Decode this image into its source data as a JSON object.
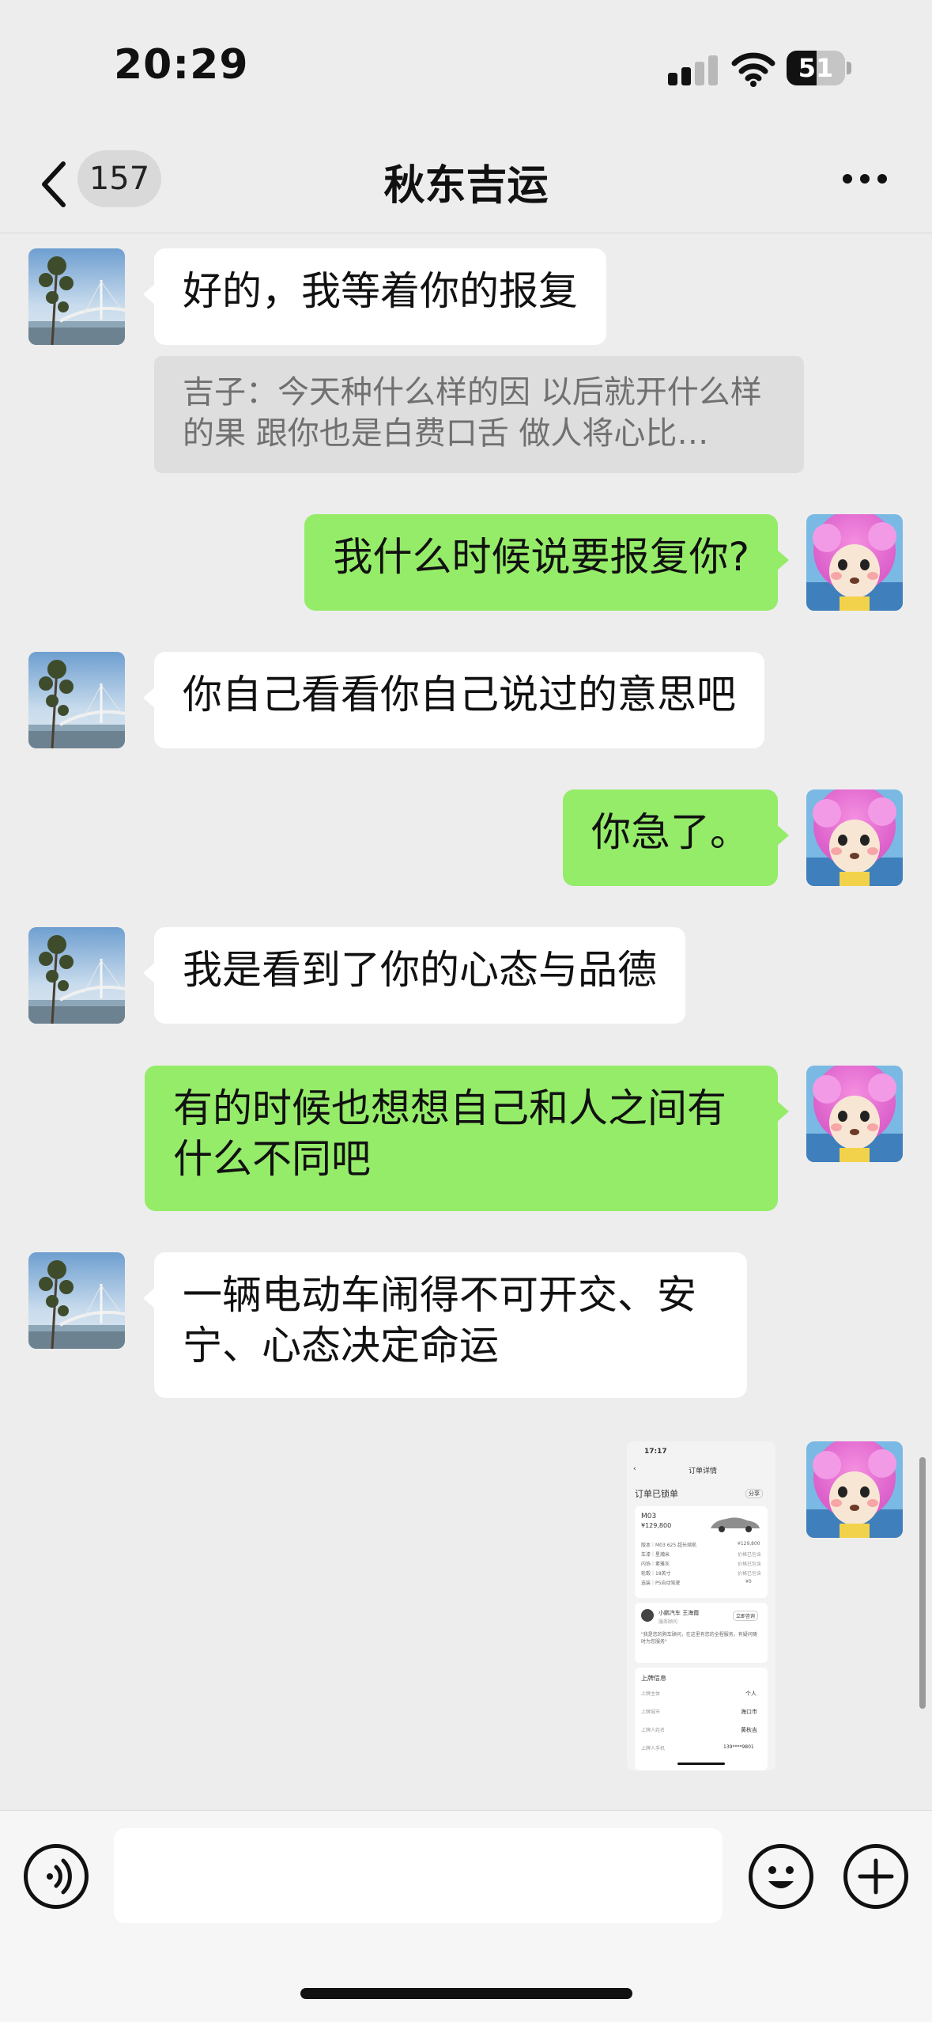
{
  "status_bar": {
    "time": "20:29",
    "battery": "51",
    "battery_level": 0.51
  },
  "nav": {
    "unread_count": "157",
    "title": "秋东吉运"
  },
  "messages": [
    {
      "side": "in",
      "text": "好的，我等着你的报复"
    },
    {
      "side": "quote",
      "text": "吉子：今天种什么样的因 以后就开什么样的果 跟你也是白费口舌 做人将心比…"
    },
    {
      "side": "out",
      "text": "我什么时候说要报复你?"
    },
    {
      "side": "in",
      "text": "你自己看看你自己说过的意思吧"
    },
    {
      "side": "out",
      "text": "你急了。"
    },
    {
      "side": "in",
      "text": "我是看到了你的心态与品德"
    },
    {
      "side": "out",
      "text": "有的时候也想想自己和人之间有什么不同吧"
    },
    {
      "side": "in",
      "text": "一辆电动车闹得不可开交、安宁、心态决定命运"
    }
  ],
  "image_message": {
    "time": "17:17",
    "title": "订单详情",
    "status": "订单已锁单",
    "status_tag": "分享",
    "model": "M03",
    "price": "¥129,800",
    "rows": [
      "版本｜M03 625 超长续航",
      "车漆｜星瀚米",
      "内饰｜素雅灰",
      "轮毂｜18英寸",
      "选装｜P5自动驾驶"
    ],
    "row_values": [
      "¥129,800",
      "价格已包含",
      "价格已包含",
      "价格已包含",
      "¥0"
    ],
    "contact_name": "小鹏汽车 王海霞",
    "contact_role": "服务顾问",
    "contact_btn": "立即咨询",
    "contact_note": "\"我是您的购车顾问，在这里有您的全程服务，有疑问随时为您服务\"",
    "plate_title": "上牌信息",
    "plate_rows": [
      [
        "上牌主体",
        "个人"
      ],
      [
        "上牌城市",
        "海口市"
      ],
      [
        "上牌人姓名",
        "黄秋吉"
      ],
      [
        "上牌人手机",
        "139****9801"
      ]
    ]
  },
  "colors": {
    "background": "#ededed",
    "incoming_bubble": "#ffffff",
    "outgoing_bubble": "#95ec69"
  }
}
